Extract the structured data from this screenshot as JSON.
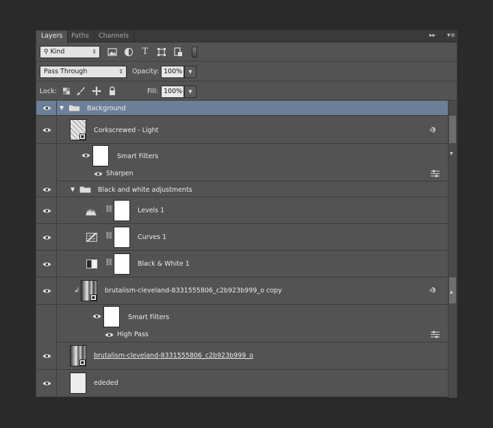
{
  "tabs": [
    "Layers",
    "Paths",
    "Channels"
  ],
  "tab_menu": {
    "expand": "▸▸",
    "menu": "▾≡"
  },
  "filter": {
    "kind_label": "Kind",
    "kind_icon": "search-icon",
    "icons": [
      "image-filter-icon",
      "adjustment-filter-icon",
      "type-filter-icon",
      "shape-filter-icon",
      "smart-object-filter-icon",
      "filter-toggle"
    ]
  },
  "blend": {
    "mode": "Pass Through",
    "opacity_label": "Opacity:",
    "opacity_value": "100%"
  },
  "lock": {
    "label": "Lock:",
    "icons": [
      "lock-transparent-icon",
      "lock-brush-icon",
      "lock-position-icon",
      "lock-all-icon"
    ],
    "fill_label": "Fill:",
    "fill_value": "100%"
  },
  "layers": [
    {
      "kind": "group",
      "name": "Background",
      "expanded": true,
      "selected": true
    },
    {
      "kind": "smart",
      "name": "Corkscrewed - Light"
    },
    {
      "kind": "smart-filters",
      "name": "Smart Filters"
    },
    {
      "kind": "filter",
      "name": "Sharpen"
    },
    {
      "kind": "group",
      "name": "Black and white adjustments",
      "expanded": true
    },
    {
      "kind": "adjustment",
      "name": "Levels 1",
      "icon": "levels-icon"
    },
    {
      "kind": "adjustment",
      "name": "Curves 1",
      "icon": "curves-icon"
    },
    {
      "kind": "adjustment",
      "name": "Black & White 1",
      "icon": "black-white-icon"
    },
    {
      "kind": "smart",
      "name": "brutalism-cleveland-8331555806_c2b923b999_o  copy",
      "clipped": true
    },
    {
      "kind": "smart-filters",
      "name": "Smart Filters"
    },
    {
      "kind": "filter",
      "name": "High Pass"
    },
    {
      "kind": "smart",
      "name": "brutalism-cleveland-8331555806_c2b923b999_o"
    },
    {
      "kind": "pixel",
      "name": "ededed"
    }
  ]
}
